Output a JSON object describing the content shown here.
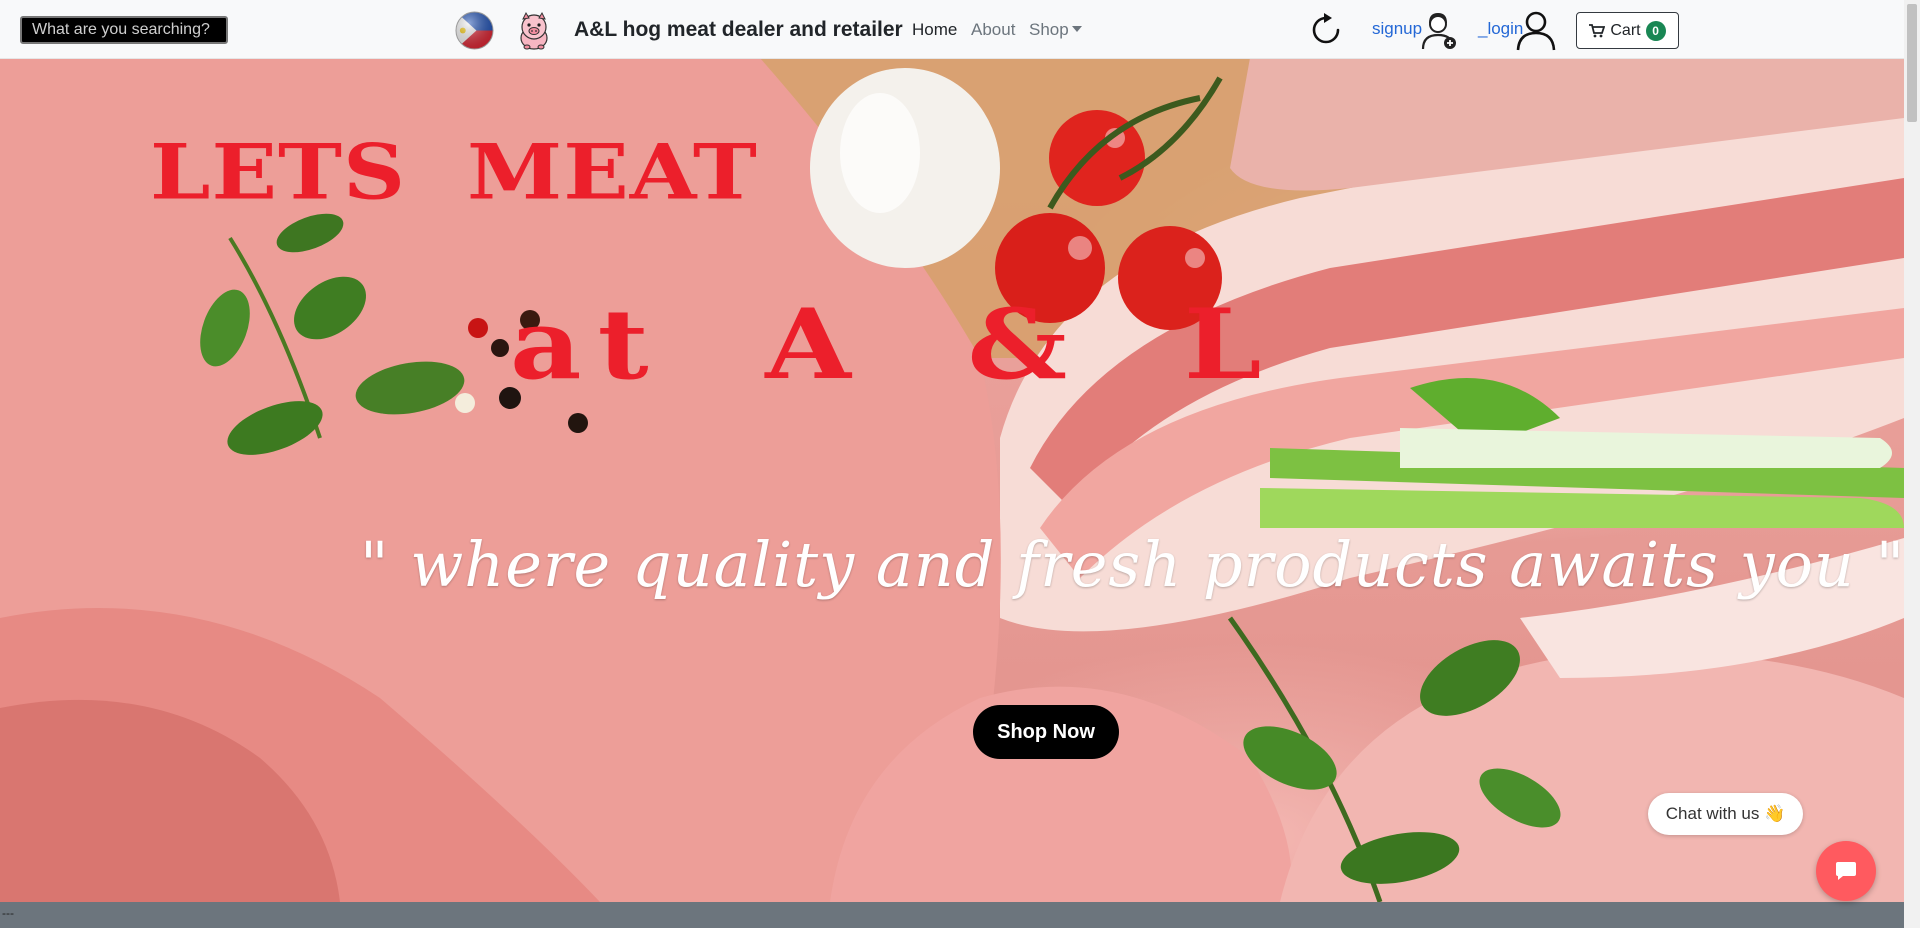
{
  "search": {
    "placeholder": "What are you searching?"
  },
  "brand": {
    "name": "A&L hog meat dealer and retailer"
  },
  "nav": {
    "home": "Home",
    "about": "About",
    "shop": "Shop"
  },
  "auth": {
    "signup": "signup",
    "login": "_login"
  },
  "cart": {
    "label": "Cart",
    "count": "0"
  },
  "hero": {
    "headline_line1": "LETS  MEAT",
    "headline_line2": "at  A & L",
    "tagline": "\" where quality and fresh products awaits you \"",
    "cta": "Shop Now"
  },
  "chat": {
    "label": "Chat with us 👋"
  },
  "footer": {
    "text": "---"
  },
  "colors": {
    "headline": "#ec1f2b",
    "link": "#2468d6",
    "cart_badge": "#198754",
    "chat_button": "#ff5a5f",
    "footer": "#6c757d"
  },
  "icons": [
    "flag-icon",
    "pig-logo-icon",
    "reload-icon",
    "signup-user-icon",
    "login-user-icon",
    "cart-icon",
    "chat-icon"
  ]
}
